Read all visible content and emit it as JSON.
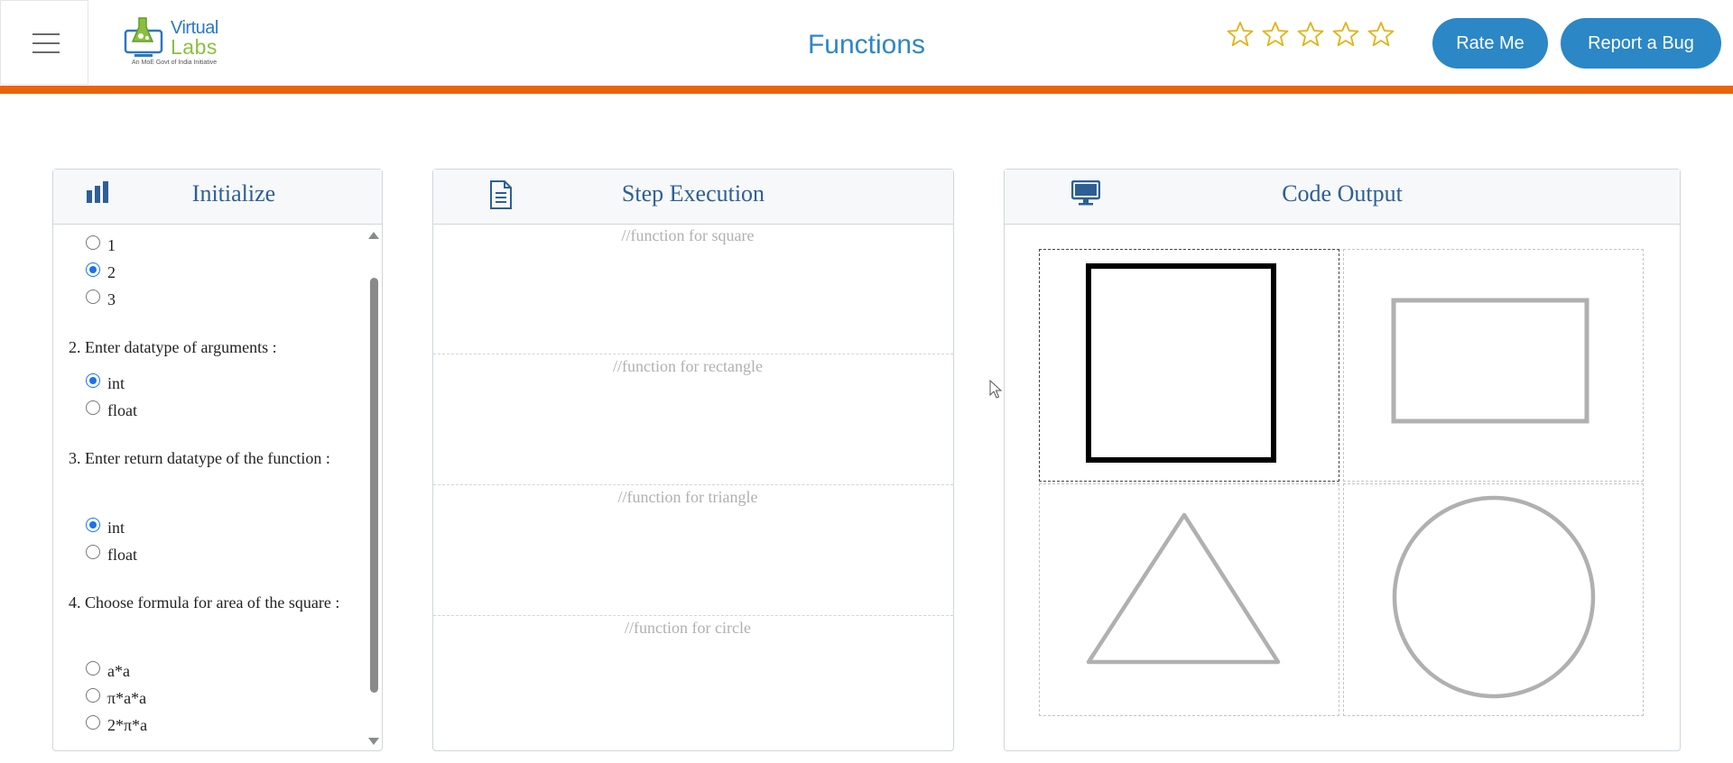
{
  "header": {
    "title": "Functions",
    "logo": {
      "line1": "Virtual",
      "line2": "Labs",
      "tagline": "An MoE Govt of India Initiative"
    },
    "rating": {
      "stars": 5,
      "filled": 0
    },
    "rate_label": "Rate Me",
    "bug_label": "Report a Bug"
  },
  "panels": {
    "initialize": {
      "title": "Initialize",
      "arg_count_options": [
        "1",
        "2",
        "3"
      ],
      "arg_count_selected": "2",
      "q2": "2. Enter datatype of arguments :",
      "q2_options": [
        "int",
        "float"
      ],
      "q2_selected": "int",
      "q3": "3. Enter return datatype of the function :",
      "q3_options": [
        "int",
        "float"
      ],
      "q3_selected": "int",
      "q4": "4. Choose formula for area of the square :",
      "q4_options": [
        "a*a",
        "π*a*a",
        "2*π*a"
      ],
      "q4_selected": null
    },
    "step": {
      "title": "Step Execution",
      "rows": [
        "//function for square",
        "//function for rectangle",
        "//function for triangle",
        "//function for circle"
      ]
    },
    "output": {
      "title": "Code Output",
      "shapes": [
        "square",
        "rectangle",
        "triangle",
        "circle"
      ],
      "active_shape": "square",
      "active_color": "#000000",
      "inactive_color": "#b0b0b0"
    }
  },
  "colors": {
    "accent": "#2b87c6",
    "orange_bar": "#ec6408",
    "title": "#2d86c8"
  }
}
